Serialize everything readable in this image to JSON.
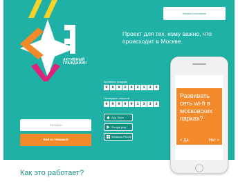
{
  "header": {
    "top_button_label": "Начать голосовать"
  },
  "logo": {
    "brand_line1": "АКТИВНЫЙ",
    "brand_line2": "ГРАЖДАНИН"
  },
  "hero": {
    "tagline": "Проект для тех, кому важно, что происходит в Москве."
  },
  "stats": [
    {
      "label": "Активных граждан",
      "digits": [
        "0",
        "0",
        "0",
        "2",
        "6",
        "2",
        "1",
        "3",
        "3"
      ]
    },
    {
      "label": "Проведено опросов",
      "digits": [
        "0",
        "0",
        "0",
        "0",
        "0",
        "1",
        "3",
        "3",
        "3"
      ]
    }
  ],
  "stores": [
    {
      "label": "App Store",
      "icon": "apple-icon"
    },
    {
      "label": "Google play",
      "icon": "google-play-icon"
    },
    {
      "label": "Windows Phone",
      "icon": "windows-icon"
    }
  ],
  "login": {
    "phone_placeholder": "Телефон",
    "button_label": "Войти / Моммой"
  },
  "phone_mockup": {
    "question": "Развивать сеть wi-fi в московских парках?",
    "yes": "< Да",
    "no": "Нет >"
  },
  "section": {
    "title": "Как это работает?"
  },
  "colors": {
    "teal": "#1fb1a5",
    "orange": "#f2892a",
    "magenta": "#e0237a",
    "yellow": "#f7d328",
    "white": "#ffffff"
  }
}
